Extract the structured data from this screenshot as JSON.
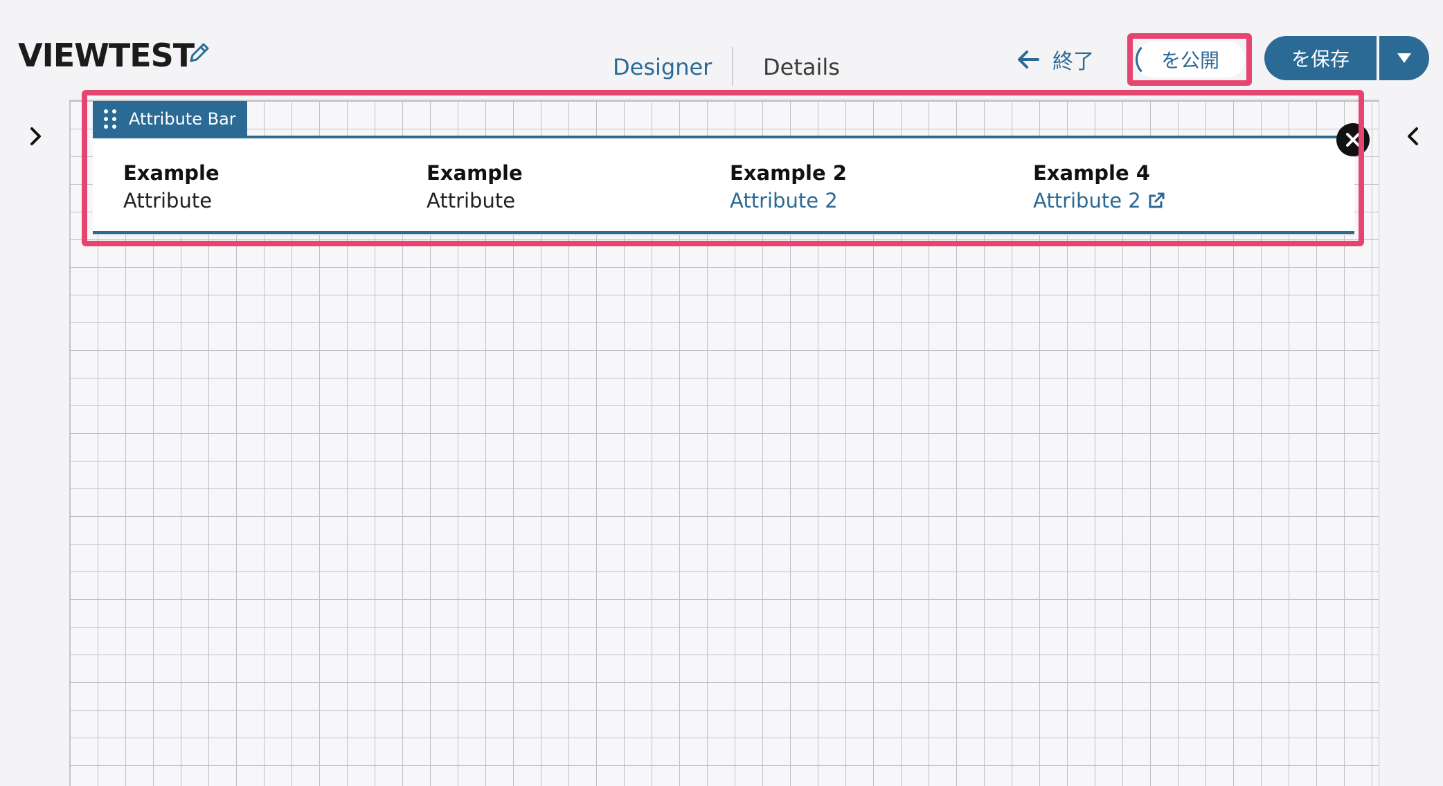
{
  "header": {
    "title": "VIEWTEST",
    "tabs": [
      {
        "label": "Designer",
        "active": true
      },
      {
        "label": "Details",
        "active": false
      }
    ],
    "exit_label": "終了",
    "publish_label": "を公開",
    "save_label": "を保存"
  },
  "widget": {
    "label": "Attribute Bar",
    "items": [
      {
        "name": "Example",
        "value": "Attribute",
        "link": false
      },
      {
        "name": "Example",
        "value": "Attribute",
        "link": false
      },
      {
        "name": "Example 2",
        "value": "Attribute 2",
        "link": true
      },
      {
        "name": "Example 4",
        "value": "Attribute 2",
        "link": true,
        "external": true
      }
    ]
  },
  "icons": {
    "edit": "pencil-icon",
    "exit": "arrow-left-icon",
    "dropdown": "caret-down-icon",
    "external": "external-link-icon",
    "panel_left": "chevron-right-icon",
    "panel_right": "chevron-left-icon",
    "drag": "drag-handle-icon",
    "close": "close-icon"
  },
  "colors": {
    "accent": "#2b6a94",
    "highlight": "#e6456f"
  }
}
